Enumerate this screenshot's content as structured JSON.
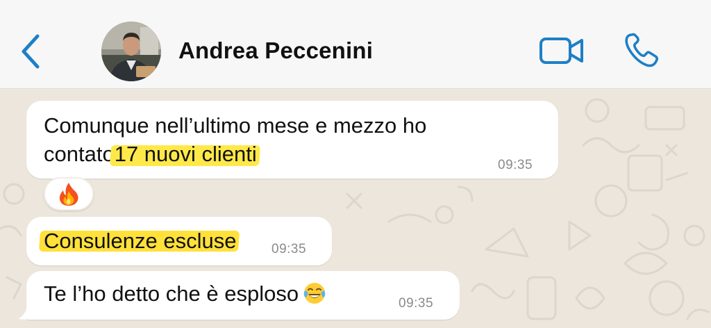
{
  "header": {
    "contact_name": "Andrea Peccenini",
    "icons": {
      "back": "chevron-left-icon",
      "video": "video-camera-icon",
      "call": "phone-icon"
    },
    "accent_color": "#1d7fc6"
  },
  "messages": [
    {
      "text_line1": "Comunque nell’ultimo mese e mezzo ho",
      "text_line2_prefix": "contato",
      "text_line2_highlight": " 17 nuovi clienti",
      "time": "09:35",
      "reaction": "fire-emoji"
    },
    {
      "text_highlight": "Consulenze escluse",
      "time": "09:35"
    },
    {
      "text": "Te l’ho detto che è esploso",
      "emoji": "tears-of-joy-emoji",
      "time": "09:35"
    }
  ],
  "colors": {
    "header_bg": "#f7f7f7",
    "chat_bg": "#ece6dc",
    "bubble_bg": "#ffffff",
    "highlight": "#ffe94a",
    "timestamp": "#8a8a8a"
  }
}
